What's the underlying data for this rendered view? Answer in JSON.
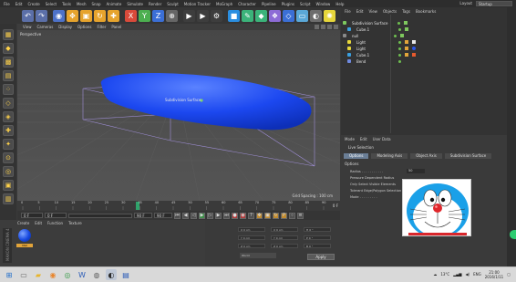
{
  "menubar": {
    "items": [
      "File",
      "Edit",
      "Create",
      "Select",
      "Tools",
      "Mesh",
      "Snap",
      "Animate",
      "Simulate",
      "Render",
      "Sculpt",
      "Motion Tracker",
      "MoGraph",
      "Character",
      "Pipeline",
      "Plugins",
      "Script",
      "Window",
      "Help"
    ],
    "layout_label": "Layout",
    "layout_value": "Startup"
  },
  "viewport": {
    "menu": [
      "View",
      "Cameras",
      "Display",
      "Options",
      "Filter",
      "Panel"
    ],
    "label": "Perspective",
    "object_label": "Subdivision Surface",
    "grid_spacing": "Grid Spacing : 100 cm"
  },
  "timeline": {
    "ticks": [
      "0",
      "5",
      "10",
      "15",
      "20",
      "25",
      "30",
      "35",
      "40",
      "45",
      "50",
      "55",
      "60",
      "65",
      "70",
      "75",
      "80",
      "85",
      "90"
    ],
    "frame_display": "0 F",
    "start_field": "0 F",
    "current_field": "0 F",
    "end_field": "90 F",
    "end_field2": "90 F"
  },
  "material_manager": {
    "menu": [
      "Create",
      "Edit",
      "Function",
      "Texture"
    ],
    "material_name": "Mat"
  },
  "coordinates": {
    "rows": [
      {
        "a": "X  0 cm",
        "b": "X  0 cm",
        "c": "H  0 °"
      },
      {
        "a": "Y  0 cm",
        "b": "Y  0 cm",
        "c": "P  0 °"
      },
      {
        "a": "Z  0 cm",
        "b": "Z  0 cm",
        "c": "B  0 °"
      }
    ],
    "world": "World",
    "size": "Size",
    "apply": "Apply"
  },
  "object_manager": {
    "menu": [
      "File",
      "Edit",
      "View",
      "Objects",
      "Tags",
      "Bookmarks"
    ],
    "objects": [
      {
        "name": "Subdivision Surface"
      },
      {
        "name": "Cube.1"
      },
      {
        "name": "null"
      },
      {
        "name": "Light"
      },
      {
        "name": "Light"
      },
      {
        "name": "Cube.1"
      },
      {
        "name": "Bend"
      }
    ]
  },
  "attribute_manager": {
    "menu": [
      "Mode",
      "Edit",
      "User Data"
    ],
    "title": "Live Selection",
    "tabs": [
      "Options",
      "Modeling Axis",
      "Object Axis",
      "Subdivision Surface"
    ],
    "section": "Options",
    "radius_label": "Radius . . . . . . . . . . .",
    "radius_value": "50",
    "line2": "Pressure Dependent Radius",
    "line3": "Only Select Visible Elements",
    "line4": "Tolerant Edge/Polygon Selection",
    "line5": "Mode . . . . . . . . ."
  },
  "taskbar": {
    "temperature": "13°C",
    "language": "ENG",
    "time": "21:00",
    "date": "2016/1/11"
  },
  "colors": {
    "object_blue": "#1f4fe8",
    "accent_orange": "#e2a43a",
    "active_tab": "#6a7e96"
  }
}
